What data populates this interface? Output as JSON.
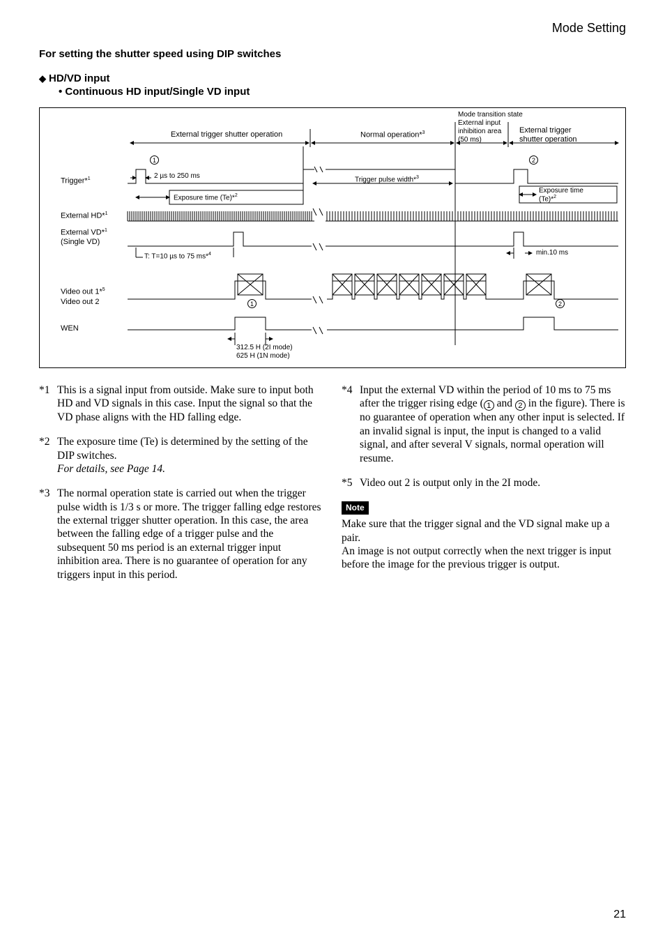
{
  "header": {
    "title": "Mode Setting"
  },
  "section_title": "For setting the shutter speed using DIP switches",
  "sub1": "HD/VD input",
  "sub2": "• Continuous HD input/Single VD input",
  "diagram": {
    "top_labels": {
      "ext_trigger_op": "External trigger shutter operation",
      "normal_op": "Normal operation*",
      "normal_op_sup": "3",
      "mode_transition_1": "Mode transition state",
      "mode_transition_2": "External input",
      "mode_transition_3": "inhibition area",
      "mode_transition_4": "(50 ms)",
      "ext_trigger_op2_1": "External trigger",
      "ext_trigger_op2_2": "shutter operation"
    },
    "left_labels": {
      "trigger": "Trigger*",
      "trigger_sup": "1",
      "ext_hd": "External HD*",
      "ext_hd_sup": "1",
      "ext_vd": "External VD*",
      "ext_vd_sup": "1",
      "single_vd": "(Single VD)",
      "vout1": "Video out 1*",
      "vout1_sup": "5",
      "vout2": "Video out 2",
      "wen": "WEN"
    },
    "inline": {
      "pulse_range": "2 µs to 250 ms",
      "exposure_time": "Exposure time (Te)*",
      "exposure_time_sup": "2",
      "trigger_pulse_width": "Trigger pulse width*",
      "trigger_pulse_width_sup": "3",
      "exposure_time_r": "Exposure time",
      "exposure_time_r2": "(Te)*",
      "exposure_time_r2_sup": "2",
      "t_period": "T: T=10 µs to 75 ms*",
      "t_period_sup": "4",
      "min10": "min.10 ms",
      "bottom_1": "312.5 H (2I mode)",
      "bottom_2": "625 H (1N mode)",
      "circ1": "1",
      "circ2": "2"
    }
  },
  "footnotes": {
    "f1": "This is a signal input from outside. Make sure to input both HD and VD signals in this case. Input the signal so that the VD phase aligns with the HD falling edge.",
    "f2_a": "The exposure time (Te) is determined by the setting of the DIP switches.",
    "f2_b": "For details, see Page 14.",
    "f3": "The normal operation state is carried out when the trigger pulse width is 1/3 s or more. The trigger falling edge restores the external trigger shutter operation. In this case, the area between the falling edge of a trigger pulse and the subsequent 50 ms period is an external trigger input inhibition area. There is no guarantee of operation for any triggers input in this period.",
    "f4_a": "Input the external VD within the period of 10 ms to 75 ms after the trigger rising edge (",
    "f4_b": " and ",
    "f4_c": " in the figure). There is no guarantee of operation when any other input is selected. If an invalid signal is input, the input is changed to a valid signal, and after several V signals, normal operation will resume.",
    "f5": "Video out 2 is output only in the 2I mode."
  },
  "note": {
    "label": "Note",
    "body1": "Make sure that the trigger signal and the VD signal make up a pair.",
    "body2": "An image is not output correctly when the next trigger is input before the image for the previous trigger is output."
  },
  "page_number": "21"
}
